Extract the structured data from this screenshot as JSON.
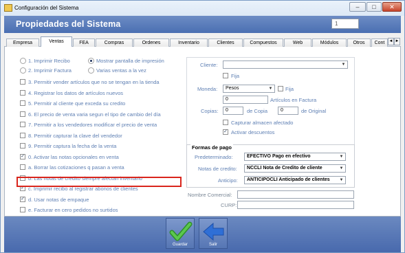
{
  "window": {
    "title": "Configuración del Sistema",
    "controls": [
      "–",
      "□",
      "✕"
    ]
  },
  "header": {
    "title": "Propiedades del Sistema",
    "box_value": "1"
  },
  "tabs": [
    "Empresa",
    "Ventas",
    "FEA",
    "Compras",
    "Ordenes",
    "Inventario",
    "Clientes",
    "Compuestos",
    "Web",
    "Módulos",
    "Otros",
    "Cont"
  ],
  "active_tab": "Ventas",
  "tab_scroll": [
    "◄",
    "►"
  ],
  "left": {
    "radio1": "1. Imprimir Recibo",
    "radio2": "2. Imprimir Factura",
    "radio3": "Mostrar pantalla de impresión",
    "radio4": "Varias ventas a la vez",
    "options": [
      {
        "label": "3. Permitir vender artículos que no se tengan en la tienda",
        "checked": false
      },
      {
        "label": "4. Registrar los datos de artículos nuevos",
        "checked": false
      },
      {
        "label": "5. Permitir al cliente que exceda su credito",
        "checked": false
      },
      {
        "label": "6. El precio de venta varia segun el tipo de cambio del día",
        "checked": false
      },
      {
        "label": "7. Permitir a los vendedores modificar el precio de venta",
        "checked": false
      },
      {
        "label": "8. Permitir capturar la clave del vendedor",
        "checked": false
      },
      {
        "label": "9. Permitir captura la fecha de la venta",
        "checked": false
      },
      {
        "label": "0. Activar las notas opcionales en venta",
        "checked": true
      },
      {
        "label": "a. Borrar las cotizaciones q pasan a venta",
        "checked": false
      },
      {
        "label": "b. Las notas de credito siempre afectan inventario",
        "checked": false
      },
      {
        "label": "c. Imprimir recibo al registrar abonos de clientes",
        "checked": true
      },
      {
        "label": "d. Usar notas de empaque",
        "checked": true
      },
      {
        "label": "e. Facturar en cero pedidos no surtidos",
        "checked": false
      }
    ]
  },
  "right": {
    "cliente_label": "Cliente:",
    "cliente_value": "",
    "fija1_label": "Fija",
    "moneda_label": "Moneda:",
    "moneda_value": "Pesos",
    "fija2_label": "Fija",
    "articulos_value": "0",
    "articulos_label": "Artículos en Factura",
    "copias_label": "Copias:",
    "copias_value": "0",
    "de_copia_label": "de Copia",
    "original_value": "0",
    "de_original_label": "de Original",
    "capturar_label": "Capturar almacen afectado",
    "activar_label": "Activar descuentos",
    "activar_checked": true
  },
  "payment": {
    "title": "Formas de pago",
    "predeterminado_label": "Predeterminado:",
    "predeterminado_value": "EFECTIVO Pago en efectivo",
    "notas_label": "Notas de credito:",
    "notas_value": "NCCLI Nota de Credito de cliente",
    "anticipo_label": "Anticipo:",
    "anticipo_value": "ANTICIPOCLI Anticipado de clientes"
  },
  "bottom_fields": {
    "nombre_label": "Nombre Comercial:",
    "nombre_value": "",
    "curp_label": "CURP:",
    "curp_value": ""
  },
  "footer": {
    "guardar_label": "Guardar",
    "salir_label": "Salir"
  },
  "colors": {
    "header_blue": "#5878b8",
    "label_blue": "#5e7fb3",
    "highlight_red": "#d9251c",
    "guardar_check": "#3fae3a",
    "salir_arrow": "#2f6fd6"
  }
}
